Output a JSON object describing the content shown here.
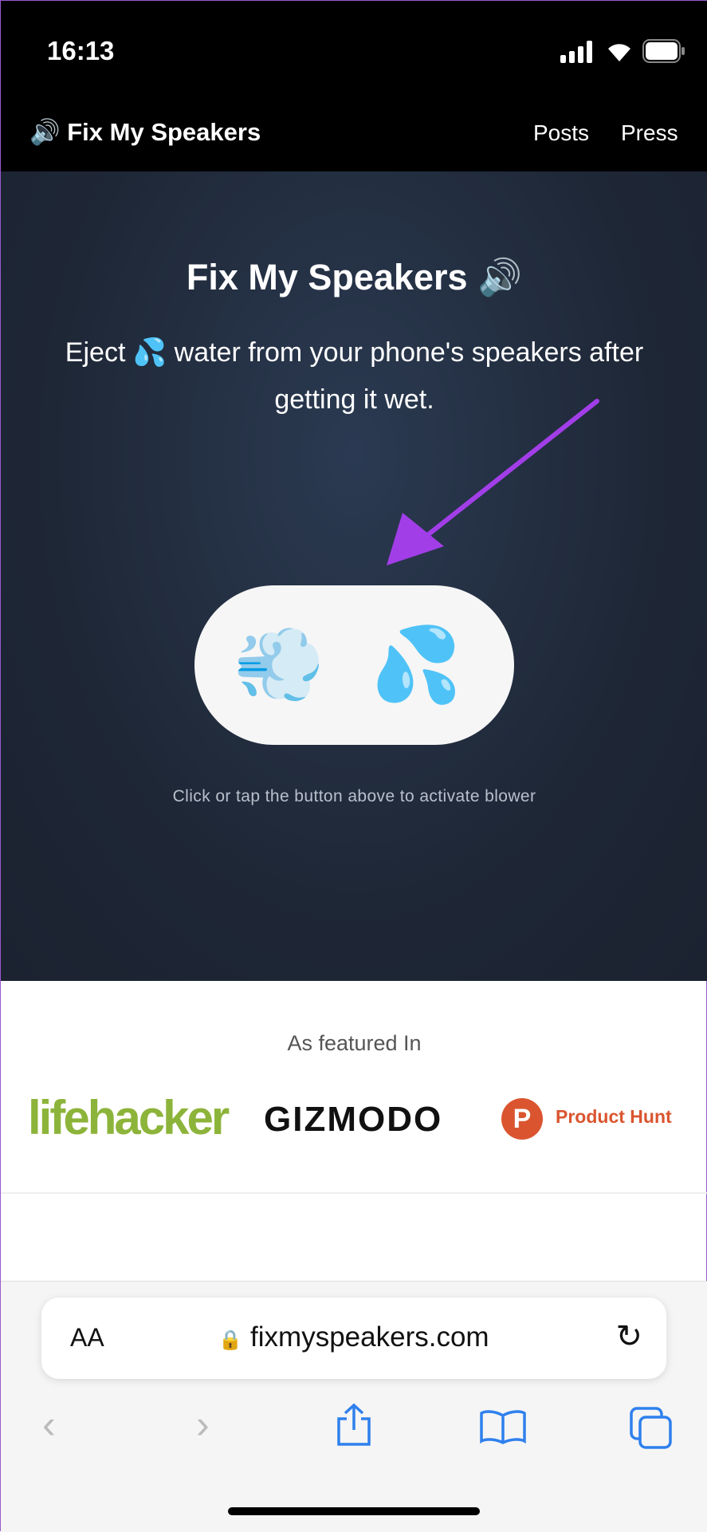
{
  "status_bar": {
    "time": "16:13"
  },
  "nav": {
    "brand_icon": "speaker-emoji",
    "brand": "Fix My Speakers",
    "links": [
      "Posts",
      "Press"
    ]
  },
  "hero": {
    "title": "Fix My Speakers",
    "title_icon": "speaker-emoji",
    "subtitle_part1": "Eject",
    "subtitle_icon": "💦",
    "subtitle_part2": "water from your phone's speakers after getting it wet.",
    "button_label": "💨 💦",
    "caption": "Click or tap the button above to activate blower",
    "arrow_color": "#a23ee8"
  },
  "featured": {
    "heading": "As featured In",
    "logos": [
      "lifehacker",
      "GIZMODO",
      "Product Hunt"
    ],
    "colors": {
      "lifehacker": "#8db43a",
      "producthunt": "#da552f"
    }
  },
  "browser": {
    "aa": "AA",
    "url": "fixmyspeakers.com",
    "accent": "#2f80ed"
  }
}
